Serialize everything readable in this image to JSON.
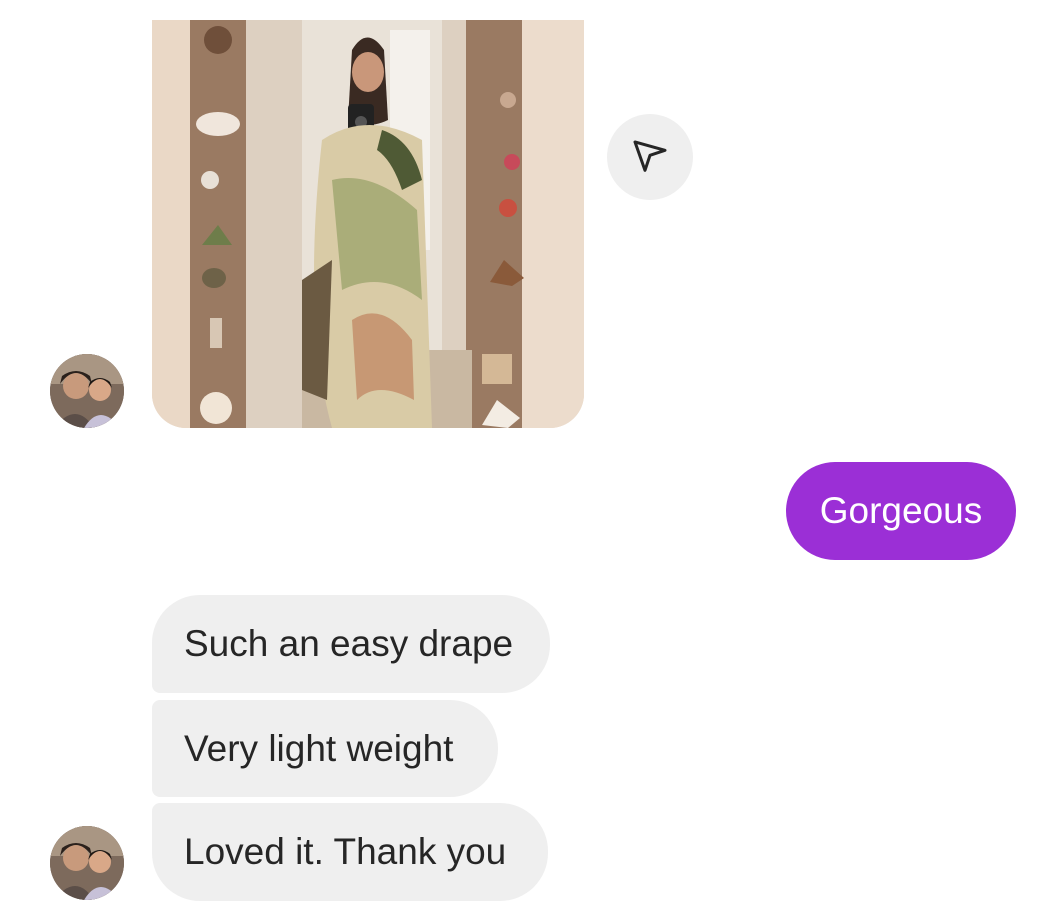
{
  "conversation": {
    "incoming_photo": {
      "type": "image",
      "subject": "mirror-selfie"
    },
    "share_button": {
      "icon": "send-icon"
    },
    "sent_messages": [
      {
        "text": "Gorgeous"
      }
    ],
    "received_messages": [
      {
        "text": "Such an easy drape"
      },
      {
        "text": "Very light weight"
      },
      {
        "text": "Loved it. Thank you"
      }
    ]
  },
  "colors": {
    "sent_bubble": "#9b2fd6",
    "received_bubble": "#efefef",
    "background": "#ffffff",
    "text": "#262626"
  }
}
